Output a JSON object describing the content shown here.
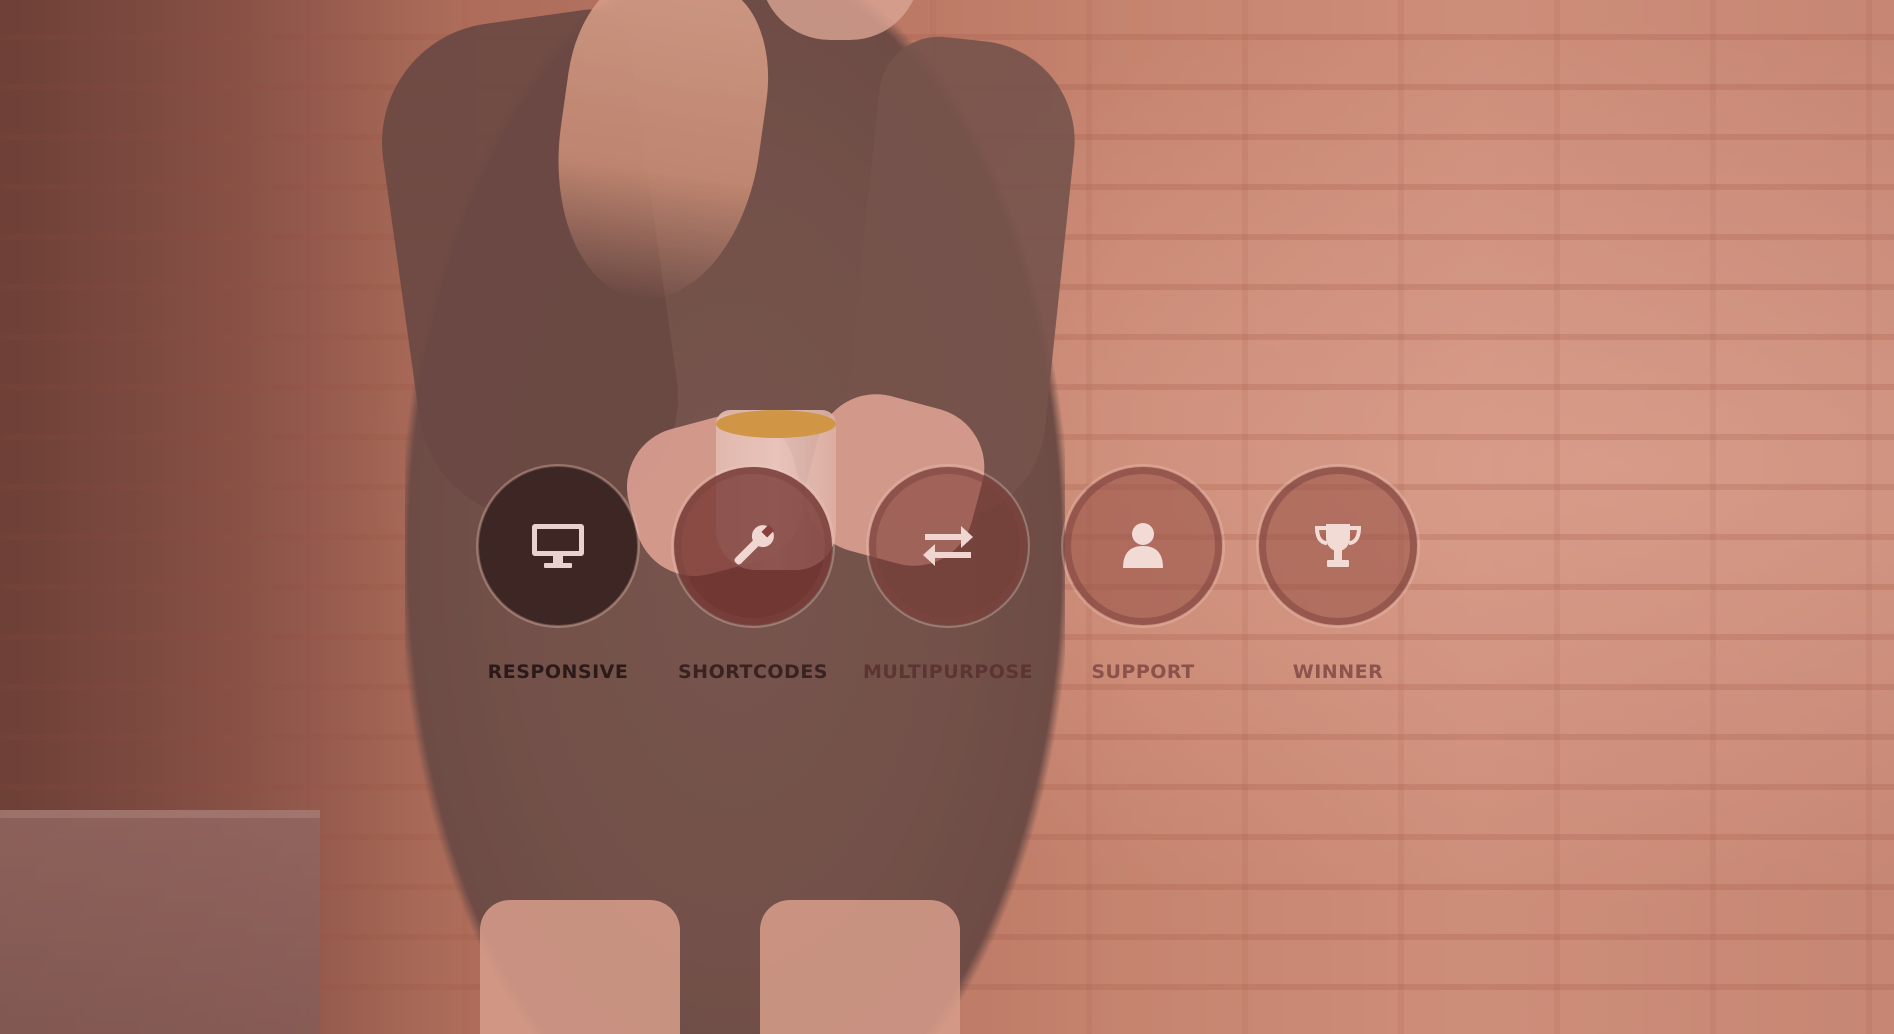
{
  "features": [
    {
      "label": "RESPONSIVE",
      "icon": "monitor-icon"
    },
    {
      "label": "SHORTCODES",
      "icon": "wrench-icon"
    },
    {
      "label": "MULTIPURPOSE",
      "icon": "exchange-arrows-icon"
    },
    {
      "label": "SUPPORT",
      "icon": "user-icon"
    },
    {
      "label": "WINNER",
      "icon": "trophy-icon"
    }
  ],
  "colors": {
    "overlay_tint": "#be6e64",
    "icon_fill": "#f2d9d4"
  }
}
